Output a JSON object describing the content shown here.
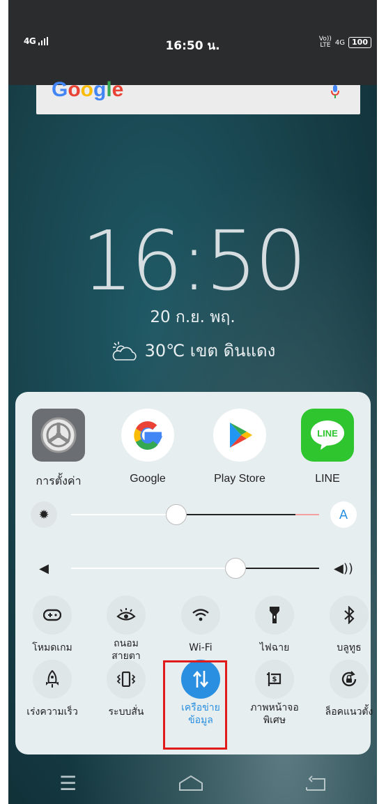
{
  "status_bar": {
    "network": "4G",
    "time": "16:50 น.",
    "volte": "Vo))\nLTE",
    "data_type": "4G",
    "battery": "100"
  },
  "search_widget": {
    "logo_text": "Google"
  },
  "lockscreen": {
    "clock": "16:50",
    "date": "20 ก.ย.  พฤ.",
    "weather": "30℃ เขต ดินแดง"
  },
  "apps": [
    {
      "label": "การตั้งค่า",
      "icon": "settings-icon"
    },
    {
      "label": "Google",
      "icon": "google-icon"
    },
    {
      "label": "Play Store",
      "icon": "play-store-icon"
    },
    {
      "label": "LINE",
      "icon": "line-icon"
    }
  ],
  "brightness": {
    "level": 0.42,
    "auto_label": "A"
  },
  "volume": {
    "level": 0.66
  },
  "toggles_row1": [
    {
      "label": "โหมดเกม",
      "icon": "gamepad-icon"
    },
    {
      "label": "ถนอม\nสายตา",
      "icon": "eye-icon"
    },
    {
      "label": "Wi-Fi",
      "icon": "wifi-icon"
    },
    {
      "label": "ไฟฉาย",
      "icon": "flashlight-icon"
    },
    {
      "label": "บลูทูธ",
      "icon": "bluetooth-icon"
    }
  ],
  "toggles_row2": [
    {
      "label": "เร่งความเร็ว",
      "icon": "rocket-icon"
    },
    {
      "label": "ระบบสั่น",
      "icon": "vibrate-icon"
    },
    {
      "label": "เครือข่าย\nข้อมูล",
      "icon": "mobile-data-icon",
      "active": true
    },
    {
      "label": "ภาพหน้าจอ\nพิเศษ",
      "icon": "screenshot-icon"
    },
    {
      "label": "ล็อคแนวตั้ง",
      "icon": "rotation-lock-icon"
    }
  ],
  "colors": {
    "active": "#2a8fe0",
    "highlight_box": "#e01b1b",
    "line_green": "#2fc52f"
  }
}
